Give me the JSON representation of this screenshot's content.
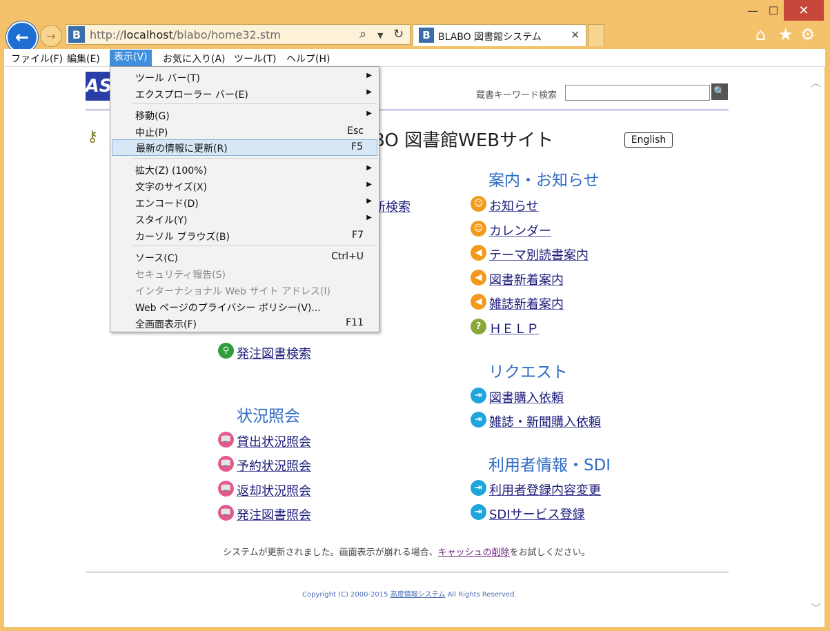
{
  "window": {
    "minimize": "—",
    "maximize": "☐",
    "close": "✕"
  },
  "address": {
    "url_prefix": "http://",
    "url_host": "localhost",
    "url_path": "/blabo/home32.stm",
    "favicon": "B"
  },
  "tab": {
    "favicon": "B",
    "title": "BLABO 図書館システム",
    "close": "✕"
  },
  "menubar": [
    {
      "label": "ファイル(F)"
    },
    {
      "label": "編集(E)"
    },
    {
      "label": "表示(V)"
    },
    {
      "label": "お気に入り(A)"
    },
    {
      "label": "ツール(T)"
    },
    {
      "label": "ヘルプ(H)"
    }
  ],
  "menu": {
    "items": [
      {
        "label": "ツール バー(T)",
        "shortcut": "",
        "submenu": true
      },
      {
        "label": "エクスプローラー バー(E)",
        "shortcut": "",
        "submenu": true
      },
      {
        "label": "移動(G)",
        "shortcut": "",
        "submenu": true
      },
      {
        "label": "中止(P)",
        "shortcut": "Esc",
        "submenu": false
      },
      {
        "label": "最新の情報に更新(R)",
        "shortcut": "F5",
        "submenu": false
      },
      {
        "label": "拡大(Z) (100%)",
        "shortcut": "",
        "submenu": true
      },
      {
        "label": "文字のサイズ(X)",
        "shortcut": "",
        "submenu": true
      },
      {
        "label": "エンコード(D)",
        "shortcut": "",
        "submenu": true
      },
      {
        "label": "スタイル(Y)",
        "shortcut": "",
        "submenu": true
      },
      {
        "label": "カーソル ブラウズ(B)",
        "shortcut": "F7",
        "submenu": false
      },
      {
        "label": "ソース(C)",
        "shortcut": "Ctrl+U",
        "submenu": false
      },
      {
        "label": "セキュリティ報告(S)",
        "shortcut": "",
        "submenu": false
      },
      {
        "label": "インターナショナル Web サイト アドレス(I)",
        "shortcut": "",
        "submenu": false
      },
      {
        "label": "Web ページのプライバシー ポリシー(V)...",
        "shortcut": "",
        "submenu": false
      },
      {
        "label": "全画面表示(F)",
        "shortcut": "F11",
        "submenu": false
      }
    ]
  },
  "page": {
    "logo": "AS",
    "search_label": "蔵書キーワード検索",
    "search_button": "🔍",
    "site_title": "BO 図書館WEBサイト",
    "english": "English",
    "partial_link": "新検索",
    "left": {
      "order_search": "発注図書検索",
      "status_heading": "状況照会",
      "status_links": [
        "貸出状況照会",
        "予約状況照会",
        "返却状況照会",
        "発注図書照会"
      ]
    },
    "right": {
      "info_heading": "案内・お知らせ",
      "info_links": [
        "お知らせ",
        "カレンダー",
        "テーマ別読書案内",
        "図書新着案内",
        "雑誌新着案内",
        "ＨＥＬＰ"
      ],
      "request_heading": "リクエスト",
      "request_links": [
        "図書購入依頼",
        "雑誌・新聞購入依頼"
      ],
      "user_heading": "利用者情報・SDI",
      "user_links": [
        "利用者登録内容変更",
        "SDIサービス登録"
      ]
    },
    "notice_before": "システムが更新されました。画面表示が崩れる場合、",
    "notice_link": "キャッシュの削除",
    "notice_after": "をお試しください。",
    "copyright_before": "Copyright (C) 2000-2015 ",
    "copyright_link": "高度情報システム",
    "copyright_after": " All Rights Reserved."
  }
}
